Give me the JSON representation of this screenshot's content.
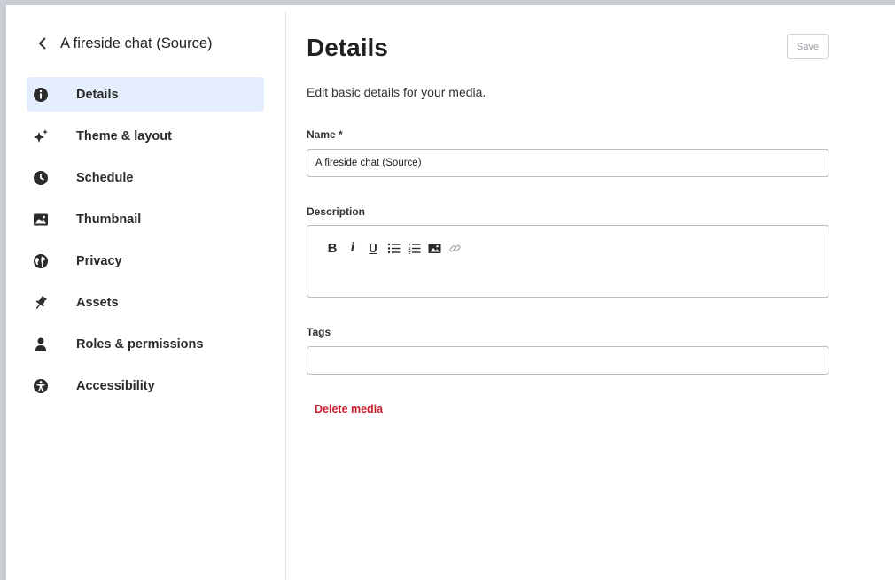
{
  "sidebar": {
    "back_title": "A fireside chat (Source)",
    "items": [
      {
        "label": "Details",
        "icon": "info-icon",
        "active": true
      },
      {
        "label": "Theme & layout",
        "icon": "sparkles-icon",
        "active": false
      },
      {
        "label": "Schedule",
        "icon": "clock-icon",
        "active": false
      },
      {
        "label": "Thumbnail",
        "icon": "image-icon",
        "active": false
      },
      {
        "label": "Privacy",
        "icon": "globe-icon",
        "active": false
      },
      {
        "label": "Assets",
        "icon": "pin-icon",
        "active": false
      },
      {
        "label": "Roles & permissions",
        "icon": "person-icon",
        "active": false
      },
      {
        "label": "Accessibility",
        "icon": "accessibility-icon",
        "active": false
      }
    ]
  },
  "main": {
    "title": "Details",
    "save_label": "Save",
    "subtitle": "Edit basic details for your media.",
    "name_label": "Name *",
    "name_value": "A fireside chat (Source)",
    "description_label": "Description",
    "toolbar": {
      "bold": "B",
      "italic": "i",
      "underline": "U",
      "icons": [
        "bold-icon",
        "italic-icon",
        "underline-icon",
        "bullet-list-icon",
        "numbered-list-icon",
        "image-icon",
        "link-icon"
      ]
    },
    "tags_label": "Tags",
    "tags_value": "",
    "delete_label": "Delete media"
  },
  "colors": {
    "active_bg": "#e3edfb",
    "danger": "#c8202f",
    "frame": "#c9ccd3"
  }
}
